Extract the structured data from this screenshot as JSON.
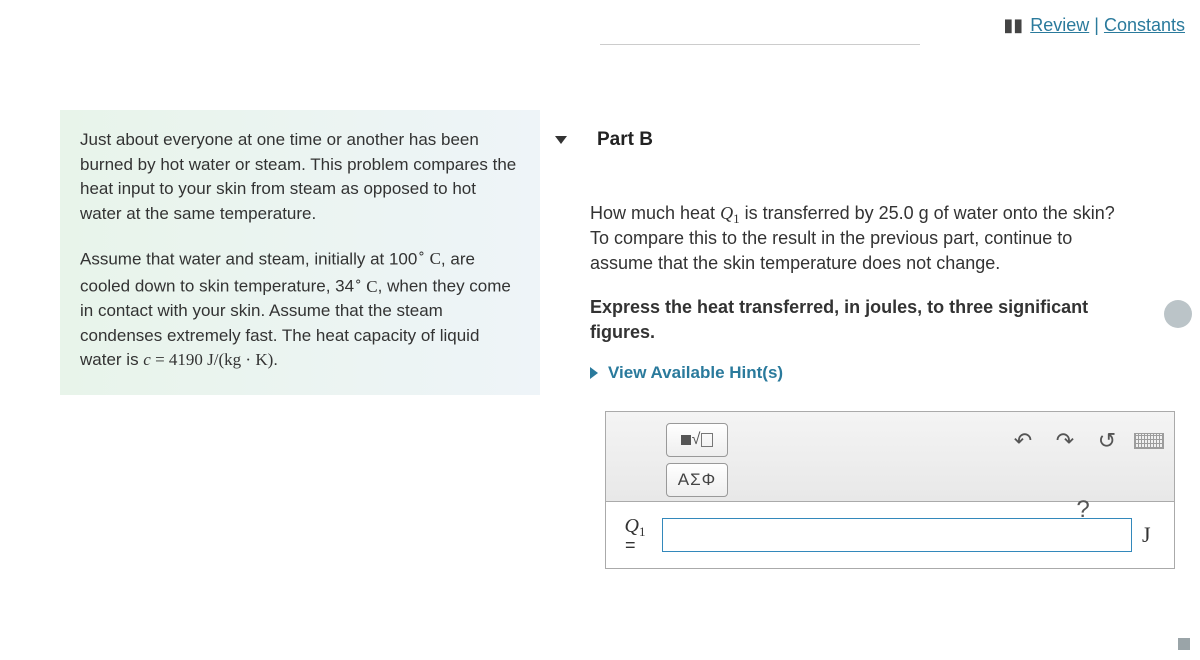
{
  "header": {
    "review_label": "Review",
    "constants_label": "Constants"
  },
  "problem": {
    "paragraph1": "Just about everyone at one time or another has been burned by hot water or steam. This problem compares the heat input to your skin from steam as opposed to hot water at the same temperature.",
    "p2_a": "Assume that water and steam, initially at 100",
    "p2_b": ", are cooled down to skin temperature, 34",
    "p2_c": ", when they come in contact with your skin. Assume that the steam condenses extremely fast. The heat capacity of liquid water is ",
    "p2_unitC": "C",
    "p2_const_var": "c",
    "p2_const_val": " = 4190 J/(kg · K)",
    "p2_end": "."
  },
  "part": {
    "label": "Part B",
    "question_a": "How much heat ",
    "question_var": "Q",
    "question_sub": "1",
    "question_b": " is transferred by 25.0 g of water onto the skin? To compare this to the result in the previous part, continue to assume that the skin temperature does not change.",
    "instruction": "Express the heat transferred, in joules, to three significant figures.",
    "hints_label": "View Available Hint(s)"
  },
  "toolbar": {
    "greek_label": "ΑΣΦ",
    "help_label": "?"
  },
  "answer": {
    "var": "Q",
    "sub": "1",
    "eq": "=",
    "unit": "J",
    "value": ""
  }
}
